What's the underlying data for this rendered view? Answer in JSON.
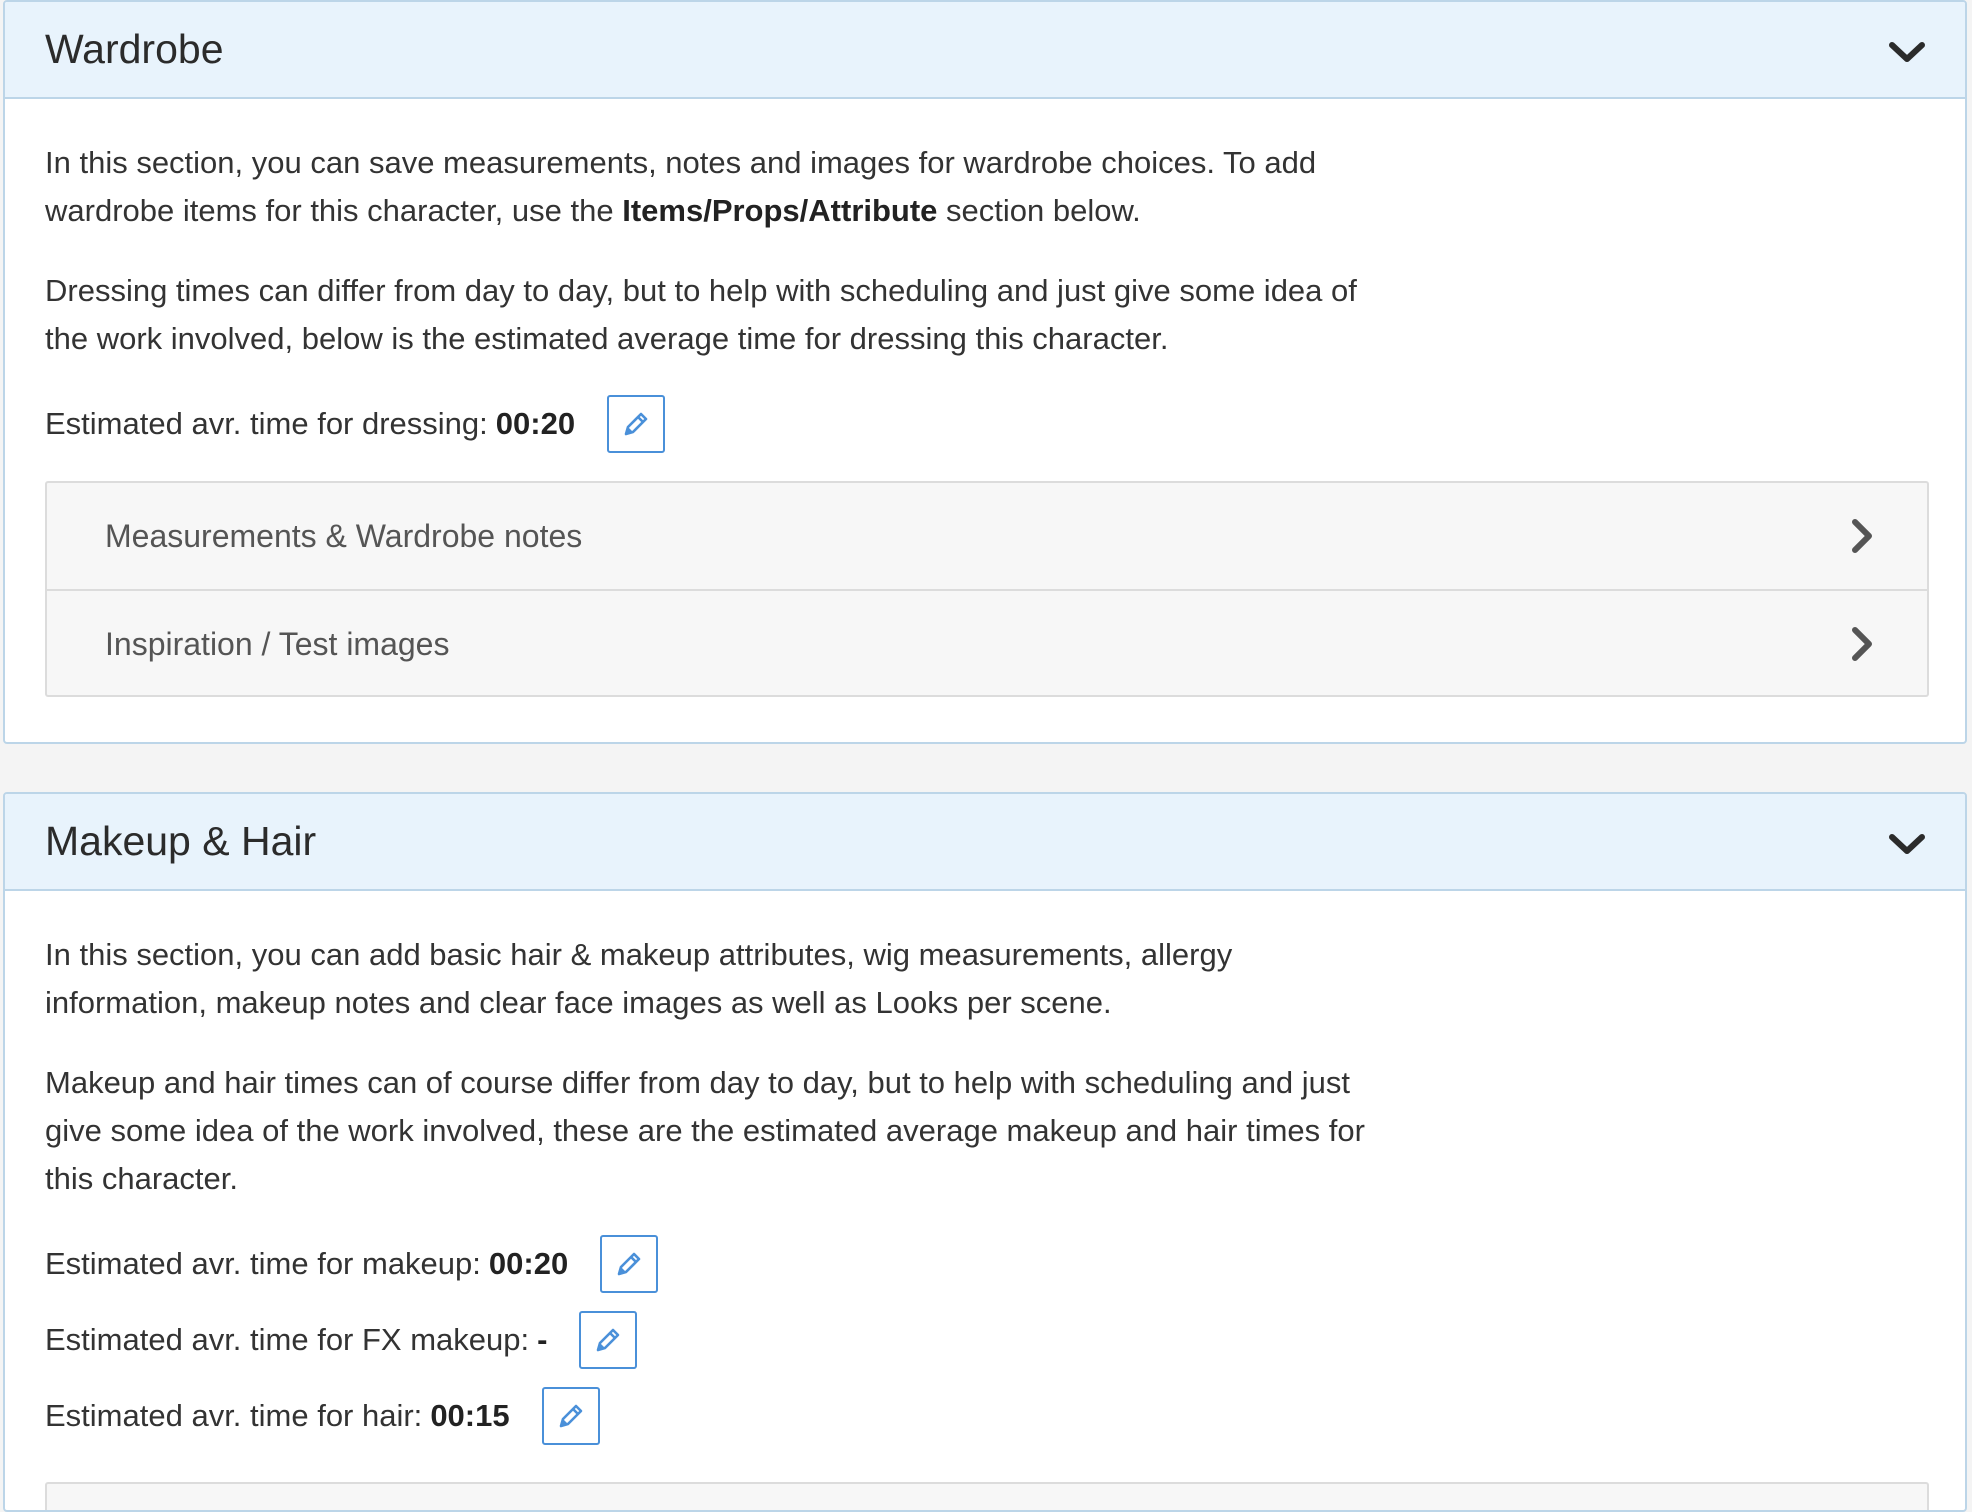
{
  "wardrobe": {
    "title": "Wardrobe",
    "intro_before": "In this section, you can save measurements, notes and images for wardrobe choices. To add wardrobe items for this character, use the ",
    "intro_bold": "Items/Props/Attribute",
    "intro_after": " section below.",
    "dressing_text": "Dressing times can differ from day to day, but to help with scheduling and just give some idea of the work involved, below is the estimated average time for dressing this character.",
    "dressing_label": "Estimated avr. time for dressing:",
    "dressing_value": "00:20",
    "accordion": [
      {
        "label": "Measurements & Wardrobe notes"
      },
      {
        "label": "Inspiration / Test images"
      }
    ]
  },
  "makeup": {
    "title": "Makeup & Hair",
    "intro": "In this section, you can add basic hair & makeup attributes, wig measurements, allergy information, makeup notes and clear face images as well as Looks per scene.",
    "times_text": "Makeup and hair times can of course differ from day to day, but to help with scheduling and just give some idea of the work involved, these are the estimated average makeup and hair times for this character.",
    "rows": [
      {
        "label": "Estimated avr. time for makeup:",
        "value": "00:20"
      },
      {
        "label": "Estimated avr. time for FX makeup:",
        "value": "-"
      },
      {
        "label": "Estimated avr. time for hair:",
        "value": "00:15"
      }
    ]
  },
  "icons": {
    "collapse": "chevron-down-icon",
    "expand": "chevron-right-icon",
    "edit": "pencil-icon"
  },
  "colors": {
    "header_bg": "#e8f3fc",
    "panel_border": "#bcd5e8",
    "accent": "#4a90d9",
    "page_bg": "#f4f4f4"
  }
}
